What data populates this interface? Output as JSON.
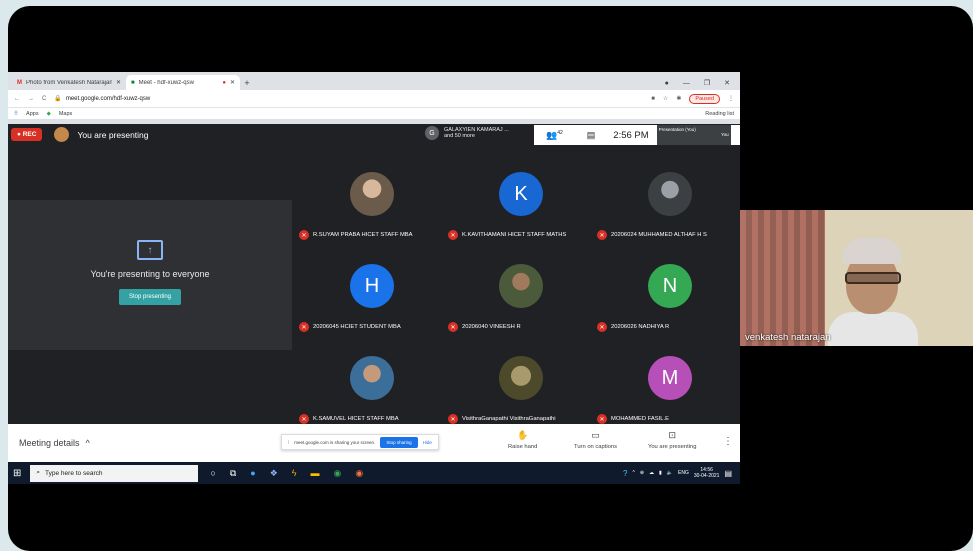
{
  "browser": {
    "tabs": [
      {
        "title": "Photo from Venkatesh Natarajan",
        "icon": "gmail-icon"
      },
      {
        "title": "Meet - hdf-xuwz-qsw",
        "icon": "meet-icon"
      }
    ],
    "url": "meet.google.com/hdf-xuwz-qsw",
    "paused_label": "Paused",
    "bookmarks": [
      "Apps",
      "Maps"
    ],
    "reading_list": "Reading list"
  },
  "meet": {
    "rec_label": "REC",
    "presenting_label": "You are presenting",
    "others": {
      "initial": "G",
      "line1": "GALAXYIEN KAMARAJ ...",
      "line2": "and 50 more"
    },
    "participant_count": "42",
    "clock": "2:56 PM",
    "thumb_label": "Presentation (You)",
    "thumb_label2": "You",
    "present_panel": {
      "title": "You're presenting to everyone",
      "button": "Stop presenting"
    },
    "participants": [
      {
        "name": "R.SUYAM PRABA HICET STAFF MBA",
        "initial": "",
        "color": "#6b5b4b"
      },
      {
        "name": "K.KAVITHAMANI HICET STAFF MATHS",
        "initial": "K",
        "color": "#1967d2"
      },
      {
        "name": "20206024 MUHHAMED ALTHAF H S",
        "initial": "",
        "color": "#5f6368"
      },
      {
        "name": "20206045 HCIET STUDENT MBA",
        "initial": "H",
        "color": "#1a73e8"
      },
      {
        "name": "20206040 VINEESH R",
        "initial": "",
        "color": "#4a5a3a"
      },
      {
        "name": "20206026 NADHIYA R",
        "initial": "N",
        "color": "#34a853"
      },
      {
        "name": "K.SAMUVEL HICET STAFF MBA",
        "initial": "",
        "color": "#3c6e9a"
      },
      {
        "name": "VisithraGanapathi VisithraGanapathi",
        "initial": "",
        "color": "#6b6a3f"
      },
      {
        "name": "MOHAMMED FASIL.E",
        "initial": "M",
        "color": "#b64fb8"
      }
    ],
    "bottom": {
      "meeting_details": "Meeting details",
      "share_text": "meet.google.com is sharing your screen.",
      "stop_sharing": "Stop sharing",
      "hide": "Hide",
      "raise_hand": "Raise hand",
      "captions": "Turn on captions",
      "you_present": "You are presenting"
    }
  },
  "taskbar": {
    "search_placeholder": "Type here to search",
    "lang": "ENG",
    "time": "14:56",
    "date": "30-04-2021"
  },
  "webcam": {
    "name": "venkatesh natarajan"
  }
}
